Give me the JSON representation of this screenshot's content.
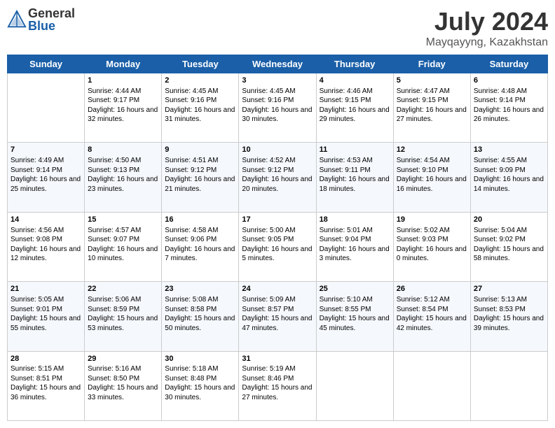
{
  "logo": {
    "general": "General",
    "blue": "Blue"
  },
  "header": {
    "month": "July 2024",
    "location": "Mayqayyng, Kazakhstan"
  },
  "weekdays": [
    "Sunday",
    "Monday",
    "Tuesday",
    "Wednesday",
    "Thursday",
    "Friday",
    "Saturday"
  ],
  "weeks": [
    [
      {
        "day": "",
        "sunrise": "",
        "sunset": "",
        "daylight": ""
      },
      {
        "day": "1",
        "sunrise": "Sunrise: 4:44 AM",
        "sunset": "Sunset: 9:17 PM",
        "daylight": "Daylight: 16 hours and 32 minutes."
      },
      {
        "day": "2",
        "sunrise": "Sunrise: 4:45 AM",
        "sunset": "Sunset: 9:16 PM",
        "daylight": "Daylight: 16 hours and 31 minutes."
      },
      {
        "day": "3",
        "sunrise": "Sunrise: 4:45 AM",
        "sunset": "Sunset: 9:16 PM",
        "daylight": "Daylight: 16 hours and 30 minutes."
      },
      {
        "day": "4",
        "sunrise": "Sunrise: 4:46 AM",
        "sunset": "Sunset: 9:15 PM",
        "daylight": "Daylight: 16 hours and 29 minutes."
      },
      {
        "day": "5",
        "sunrise": "Sunrise: 4:47 AM",
        "sunset": "Sunset: 9:15 PM",
        "daylight": "Daylight: 16 hours and 27 minutes."
      },
      {
        "day": "6",
        "sunrise": "Sunrise: 4:48 AM",
        "sunset": "Sunset: 9:14 PM",
        "daylight": "Daylight: 16 hours and 26 minutes."
      }
    ],
    [
      {
        "day": "7",
        "sunrise": "Sunrise: 4:49 AM",
        "sunset": "Sunset: 9:14 PM",
        "daylight": "Daylight: 16 hours and 25 minutes."
      },
      {
        "day": "8",
        "sunrise": "Sunrise: 4:50 AM",
        "sunset": "Sunset: 9:13 PM",
        "daylight": "Daylight: 16 hours and 23 minutes."
      },
      {
        "day": "9",
        "sunrise": "Sunrise: 4:51 AM",
        "sunset": "Sunset: 9:12 PM",
        "daylight": "Daylight: 16 hours and 21 minutes."
      },
      {
        "day": "10",
        "sunrise": "Sunrise: 4:52 AM",
        "sunset": "Sunset: 9:12 PM",
        "daylight": "Daylight: 16 hours and 20 minutes."
      },
      {
        "day": "11",
        "sunrise": "Sunrise: 4:53 AM",
        "sunset": "Sunset: 9:11 PM",
        "daylight": "Daylight: 16 hours and 18 minutes."
      },
      {
        "day": "12",
        "sunrise": "Sunrise: 4:54 AM",
        "sunset": "Sunset: 9:10 PM",
        "daylight": "Daylight: 16 hours and 16 minutes."
      },
      {
        "day": "13",
        "sunrise": "Sunrise: 4:55 AM",
        "sunset": "Sunset: 9:09 PM",
        "daylight": "Daylight: 16 hours and 14 minutes."
      }
    ],
    [
      {
        "day": "14",
        "sunrise": "Sunrise: 4:56 AM",
        "sunset": "Sunset: 9:08 PM",
        "daylight": "Daylight: 16 hours and 12 minutes."
      },
      {
        "day": "15",
        "sunrise": "Sunrise: 4:57 AM",
        "sunset": "Sunset: 9:07 PM",
        "daylight": "Daylight: 16 hours and 10 minutes."
      },
      {
        "day": "16",
        "sunrise": "Sunrise: 4:58 AM",
        "sunset": "Sunset: 9:06 PM",
        "daylight": "Daylight: 16 hours and 7 minutes."
      },
      {
        "day": "17",
        "sunrise": "Sunrise: 5:00 AM",
        "sunset": "Sunset: 9:05 PM",
        "daylight": "Daylight: 16 hours and 5 minutes."
      },
      {
        "day": "18",
        "sunrise": "Sunrise: 5:01 AM",
        "sunset": "Sunset: 9:04 PM",
        "daylight": "Daylight: 16 hours and 3 minutes."
      },
      {
        "day": "19",
        "sunrise": "Sunrise: 5:02 AM",
        "sunset": "Sunset: 9:03 PM",
        "daylight": "Daylight: 16 hours and 0 minutes."
      },
      {
        "day": "20",
        "sunrise": "Sunrise: 5:04 AM",
        "sunset": "Sunset: 9:02 PM",
        "daylight": "Daylight: 15 hours and 58 minutes."
      }
    ],
    [
      {
        "day": "21",
        "sunrise": "Sunrise: 5:05 AM",
        "sunset": "Sunset: 9:01 PM",
        "daylight": "Daylight: 15 hours and 55 minutes."
      },
      {
        "day": "22",
        "sunrise": "Sunrise: 5:06 AM",
        "sunset": "Sunset: 8:59 PM",
        "daylight": "Daylight: 15 hours and 53 minutes."
      },
      {
        "day": "23",
        "sunrise": "Sunrise: 5:08 AM",
        "sunset": "Sunset: 8:58 PM",
        "daylight": "Daylight: 15 hours and 50 minutes."
      },
      {
        "day": "24",
        "sunrise": "Sunrise: 5:09 AM",
        "sunset": "Sunset: 8:57 PM",
        "daylight": "Daylight: 15 hours and 47 minutes."
      },
      {
        "day": "25",
        "sunrise": "Sunrise: 5:10 AM",
        "sunset": "Sunset: 8:55 PM",
        "daylight": "Daylight: 15 hours and 45 minutes."
      },
      {
        "day": "26",
        "sunrise": "Sunrise: 5:12 AM",
        "sunset": "Sunset: 8:54 PM",
        "daylight": "Daylight: 15 hours and 42 minutes."
      },
      {
        "day": "27",
        "sunrise": "Sunrise: 5:13 AM",
        "sunset": "Sunset: 8:53 PM",
        "daylight": "Daylight: 15 hours and 39 minutes."
      }
    ],
    [
      {
        "day": "28",
        "sunrise": "Sunrise: 5:15 AM",
        "sunset": "Sunset: 8:51 PM",
        "daylight": "Daylight: 15 hours and 36 minutes."
      },
      {
        "day": "29",
        "sunrise": "Sunrise: 5:16 AM",
        "sunset": "Sunset: 8:50 PM",
        "daylight": "Daylight: 15 hours and 33 minutes."
      },
      {
        "day": "30",
        "sunrise": "Sunrise: 5:18 AM",
        "sunset": "Sunset: 8:48 PM",
        "daylight": "Daylight: 15 hours and 30 minutes."
      },
      {
        "day": "31",
        "sunrise": "Sunrise: 5:19 AM",
        "sunset": "Sunset: 8:46 PM",
        "daylight": "Daylight: 15 hours and 27 minutes."
      },
      {
        "day": "",
        "sunrise": "",
        "sunset": "",
        "daylight": ""
      },
      {
        "day": "",
        "sunrise": "",
        "sunset": "",
        "daylight": ""
      },
      {
        "day": "",
        "sunrise": "",
        "sunset": "",
        "daylight": ""
      }
    ]
  ]
}
